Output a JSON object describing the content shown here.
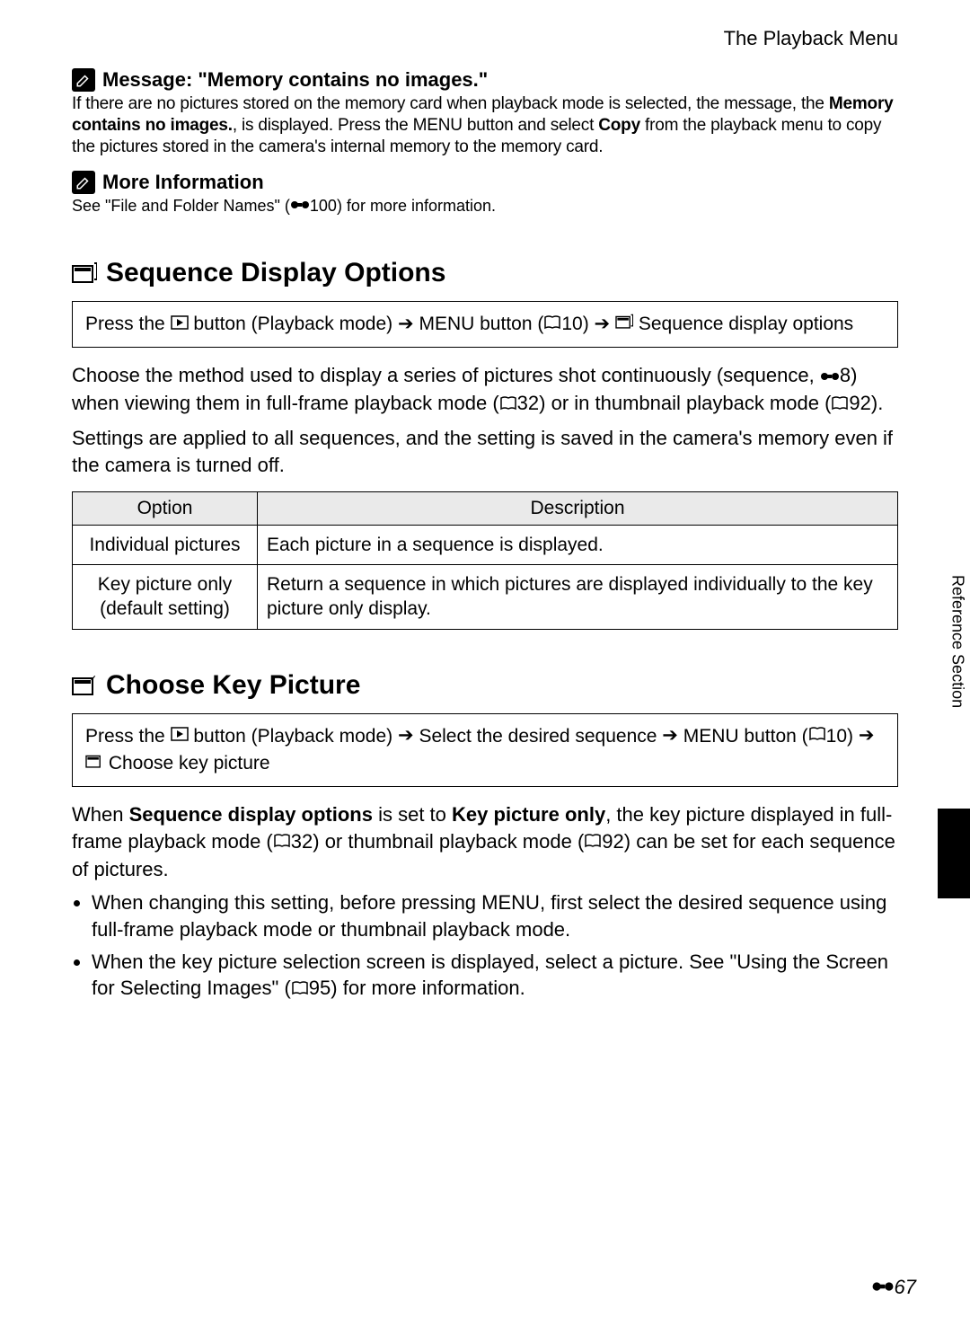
{
  "header": "The Playback Menu",
  "note1": {
    "title": "Message: \"Memory contains no images.\"",
    "seg1": "If there are no pictures stored on the memory card when playback mode is selected, the message, the ",
    "seg2": "Memory contains no images.",
    "seg3": ", is displayed. Press the ",
    "menu": "MENU",
    "seg4": " button and select ",
    "copy": "Copy",
    "seg5": " from the playback menu to copy the pictures stored in the camera's internal memory to the memory card."
  },
  "note2": {
    "title": "More Information",
    "seg1": "See \"File and Folder Names\" (",
    "ref": "100",
    "seg2": ") for more information."
  },
  "sec1": {
    "title": "Sequence Display Options",
    "nav": {
      "s1": "Press the ",
      "s2": " button (Playback mode) ",
      "menu": "MENU",
      "s3": " button (",
      "ref10": "10",
      "s4": ") ",
      "s5": " Sequence display options"
    },
    "p1a": "Choose the method used to display a series of pictures shot continuously (sequence, ",
    "ref8": "8",
    "p1b": ") when viewing them in full-frame playback mode (",
    "ref32": "32",
    "p1c": ") or in thumbnail playback mode (",
    "ref92": "92",
    "p1d": ").",
    "p2": "Settings are applied to all sequences, and the setting is saved in the camera's memory even if the camera is turned off.",
    "table": {
      "h1": "Option",
      "h2": "Description",
      "r1c1": "Individual pictures",
      "r1c2": "Each picture in a sequence is displayed.",
      "r2c1a": "Key picture only",
      "r2c1b": "(default setting)",
      "r2c2": "Return a sequence in which pictures are displayed individually to the key picture only display."
    }
  },
  "sec2": {
    "title": "Choose Key Picture",
    "nav": {
      "s1": "Press the ",
      "s2": " button (Playback mode) ",
      "s3": " Select the desired sequence ",
      "menu": "MENU",
      "s4": " button (",
      "ref10": "10",
      "s5": ") ",
      "s6": " Choose key picture"
    },
    "p1a": "When ",
    "b1": "Sequence display options",
    "p1b": " is set to ",
    "b2": "Key picture only",
    "p1c": ", the key picture displayed in full-frame playback mode (",
    "ref32": "32",
    "p1d": ") or thumbnail playback mode (",
    "ref92": "92",
    "p1e": ") can be set for each sequence of pictures.",
    "li1a": "When changing this setting, before pressing ",
    "menu": "MENU",
    "li1b": ", first select the desired sequence using full-frame playback mode or thumbnail playback mode.",
    "li2a": "When the key picture selection screen is displayed, select a picture. See \"Using the Screen for Selecting Images\" (",
    "ref95": "95",
    "li2b": ") for more information."
  },
  "side": "Reference Section",
  "pagenum": "67"
}
